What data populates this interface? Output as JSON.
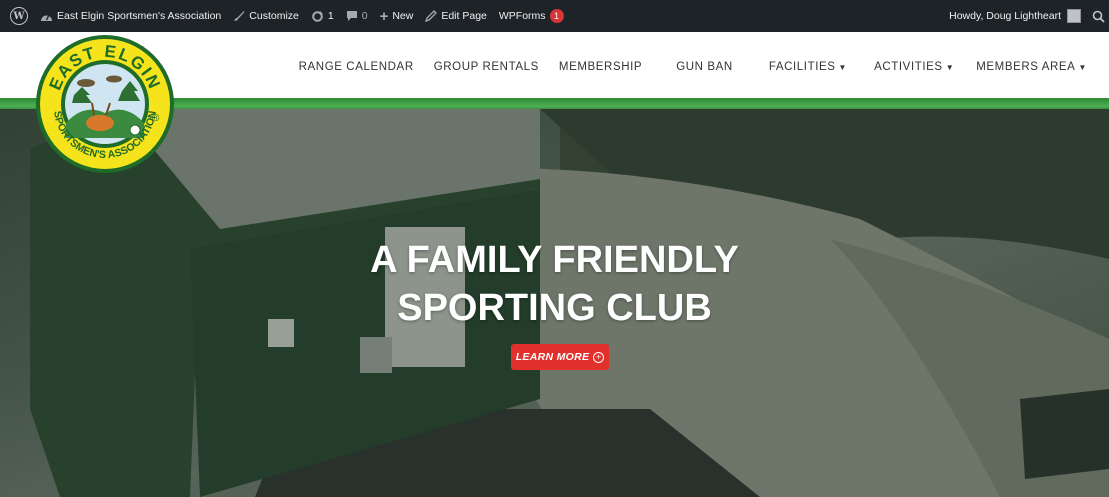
{
  "adminbar": {
    "site_name": "East Elgin Sportsmen's Association",
    "customize": "Customize",
    "updates_count": "1",
    "comments_count": "0",
    "new_label": "New",
    "edit_page": "Edit Page",
    "wpforms": "WPForms",
    "wpforms_badge": "1",
    "howdy": "Howdy, Doug Lightheart"
  },
  "logo": {
    "top_text": "EAST ELGIN",
    "bottom_text": "SPORTSMEN'S ASSOCIATION",
    "registered": "®"
  },
  "nav": {
    "items": [
      {
        "label": "RANGE CALENDAR",
        "dropdown": false
      },
      {
        "label": "GROUP RENTALS",
        "dropdown": false
      },
      {
        "label": "MEMBERSHIP",
        "dropdown": false
      },
      {
        "label": "GUN BAN",
        "dropdown": false
      },
      {
        "label": "FACILITIES",
        "dropdown": true
      },
      {
        "label": "ACTIVITIES",
        "dropdown": true
      },
      {
        "label": "MEMBERS AREA",
        "dropdown": true
      }
    ]
  },
  "hero": {
    "title_line1": "A FAMILY FRIENDLY",
    "title_line2": "SPORTING CLUB",
    "button_label": "LEARN MORE"
  },
  "colors": {
    "adminbar_bg": "#1d2327",
    "brand_green": "#2e8b34",
    "logo_yellow": "#f5e31b",
    "button_red": "#e2312d"
  }
}
